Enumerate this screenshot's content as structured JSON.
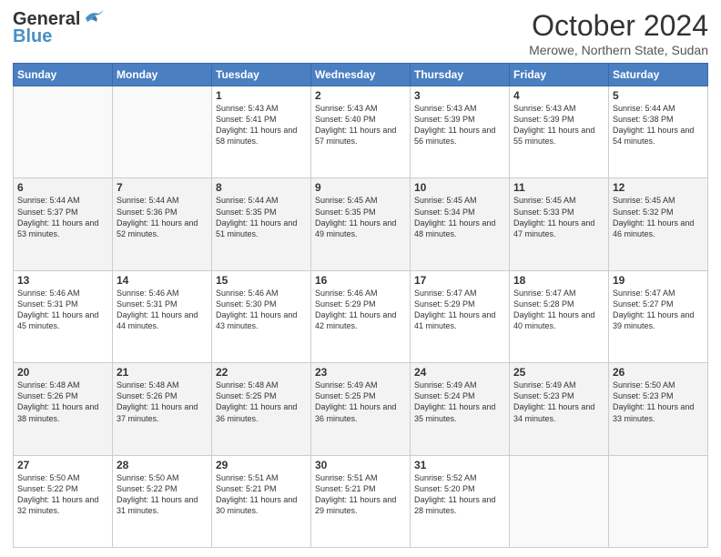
{
  "header": {
    "logo_general": "General",
    "logo_blue": "Blue",
    "month_title": "October 2024",
    "location": "Merowe, Northern State, Sudan"
  },
  "days_of_week": [
    "Sunday",
    "Monday",
    "Tuesday",
    "Wednesday",
    "Thursday",
    "Friday",
    "Saturday"
  ],
  "weeks": [
    [
      {
        "day": "",
        "info": ""
      },
      {
        "day": "",
        "info": ""
      },
      {
        "day": "1",
        "info": "Sunrise: 5:43 AM\nSunset: 5:41 PM\nDaylight: 11 hours and 58 minutes."
      },
      {
        "day": "2",
        "info": "Sunrise: 5:43 AM\nSunset: 5:40 PM\nDaylight: 11 hours and 57 minutes."
      },
      {
        "day": "3",
        "info": "Sunrise: 5:43 AM\nSunset: 5:39 PM\nDaylight: 11 hours and 56 minutes."
      },
      {
        "day": "4",
        "info": "Sunrise: 5:43 AM\nSunset: 5:39 PM\nDaylight: 11 hours and 55 minutes."
      },
      {
        "day": "5",
        "info": "Sunrise: 5:44 AM\nSunset: 5:38 PM\nDaylight: 11 hours and 54 minutes."
      }
    ],
    [
      {
        "day": "6",
        "info": "Sunrise: 5:44 AM\nSunset: 5:37 PM\nDaylight: 11 hours and 53 minutes."
      },
      {
        "day": "7",
        "info": "Sunrise: 5:44 AM\nSunset: 5:36 PM\nDaylight: 11 hours and 52 minutes."
      },
      {
        "day": "8",
        "info": "Sunrise: 5:44 AM\nSunset: 5:35 PM\nDaylight: 11 hours and 51 minutes."
      },
      {
        "day": "9",
        "info": "Sunrise: 5:45 AM\nSunset: 5:35 PM\nDaylight: 11 hours and 49 minutes."
      },
      {
        "day": "10",
        "info": "Sunrise: 5:45 AM\nSunset: 5:34 PM\nDaylight: 11 hours and 48 minutes."
      },
      {
        "day": "11",
        "info": "Sunrise: 5:45 AM\nSunset: 5:33 PM\nDaylight: 11 hours and 47 minutes."
      },
      {
        "day": "12",
        "info": "Sunrise: 5:45 AM\nSunset: 5:32 PM\nDaylight: 11 hours and 46 minutes."
      }
    ],
    [
      {
        "day": "13",
        "info": "Sunrise: 5:46 AM\nSunset: 5:31 PM\nDaylight: 11 hours and 45 minutes."
      },
      {
        "day": "14",
        "info": "Sunrise: 5:46 AM\nSunset: 5:31 PM\nDaylight: 11 hours and 44 minutes."
      },
      {
        "day": "15",
        "info": "Sunrise: 5:46 AM\nSunset: 5:30 PM\nDaylight: 11 hours and 43 minutes."
      },
      {
        "day": "16",
        "info": "Sunrise: 5:46 AM\nSunset: 5:29 PM\nDaylight: 11 hours and 42 minutes."
      },
      {
        "day": "17",
        "info": "Sunrise: 5:47 AM\nSunset: 5:29 PM\nDaylight: 11 hours and 41 minutes."
      },
      {
        "day": "18",
        "info": "Sunrise: 5:47 AM\nSunset: 5:28 PM\nDaylight: 11 hours and 40 minutes."
      },
      {
        "day": "19",
        "info": "Sunrise: 5:47 AM\nSunset: 5:27 PM\nDaylight: 11 hours and 39 minutes."
      }
    ],
    [
      {
        "day": "20",
        "info": "Sunrise: 5:48 AM\nSunset: 5:26 PM\nDaylight: 11 hours and 38 minutes."
      },
      {
        "day": "21",
        "info": "Sunrise: 5:48 AM\nSunset: 5:26 PM\nDaylight: 11 hours and 37 minutes."
      },
      {
        "day": "22",
        "info": "Sunrise: 5:48 AM\nSunset: 5:25 PM\nDaylight: 11 hours and 36 minutes."
      },
      {
        "day": "23",
        "info": "Sunrise: 5:49 AM\nSunset: 5:25 PM\nDaylight: 11 hours and 36 minutes."
      },
      {
        "day": "24",
        "info": "Sunrise: 5:49 AM\nSunset: 5:24 PM\nDaylight: 11 hours and 35 minutes."
      },
      {
        "day": "25",
        "info": "Sunrise: 5:49 AM\nSunset: 5:23 PM\nDaylight: 11 hours and 34 minutes."
      },
      {
        "day": "26",
        "info": "Sunrise: 5:50 AM\nSunset: 5:23 PM\nDaylight: 11 hours and 33 minutes."
      }
    ],
    [
      {
        "day": "27",
        "info": "Sunrise: 5:50 AM\nSunset: 5:22 PM\nDaylight: 11 hours and 32 minutes."
      },
      {
        "day": "28",
        "info": "Sunrise: 5:50 AM\nSunset: 5:22 PM\nDaylight: 11 hours and 31 minutes."
      },
      {
        "day": "29",
        "info": "Sunrise: 5:51 AM\nSunset: 5:21 PM\nDaylight: 11 hours and 30 minutes."
      },
      {
        "day": "30",
        "info": "Sunrise: 5:51 AM\nSunset: 5:21 PM\nDaylight: 11 hours and 29 minutes."
      },
      {
        "day": "31",
        "info": "Sunrise: 5:52 AM\nSunset: 5:20 PM\nDaylight: 11 hours and 28 minutes."
      },
      {
        "day": "",
        "info": ""
      },
      {
        "day": "",
        "info": ""
      }
    ]
  ]
}
